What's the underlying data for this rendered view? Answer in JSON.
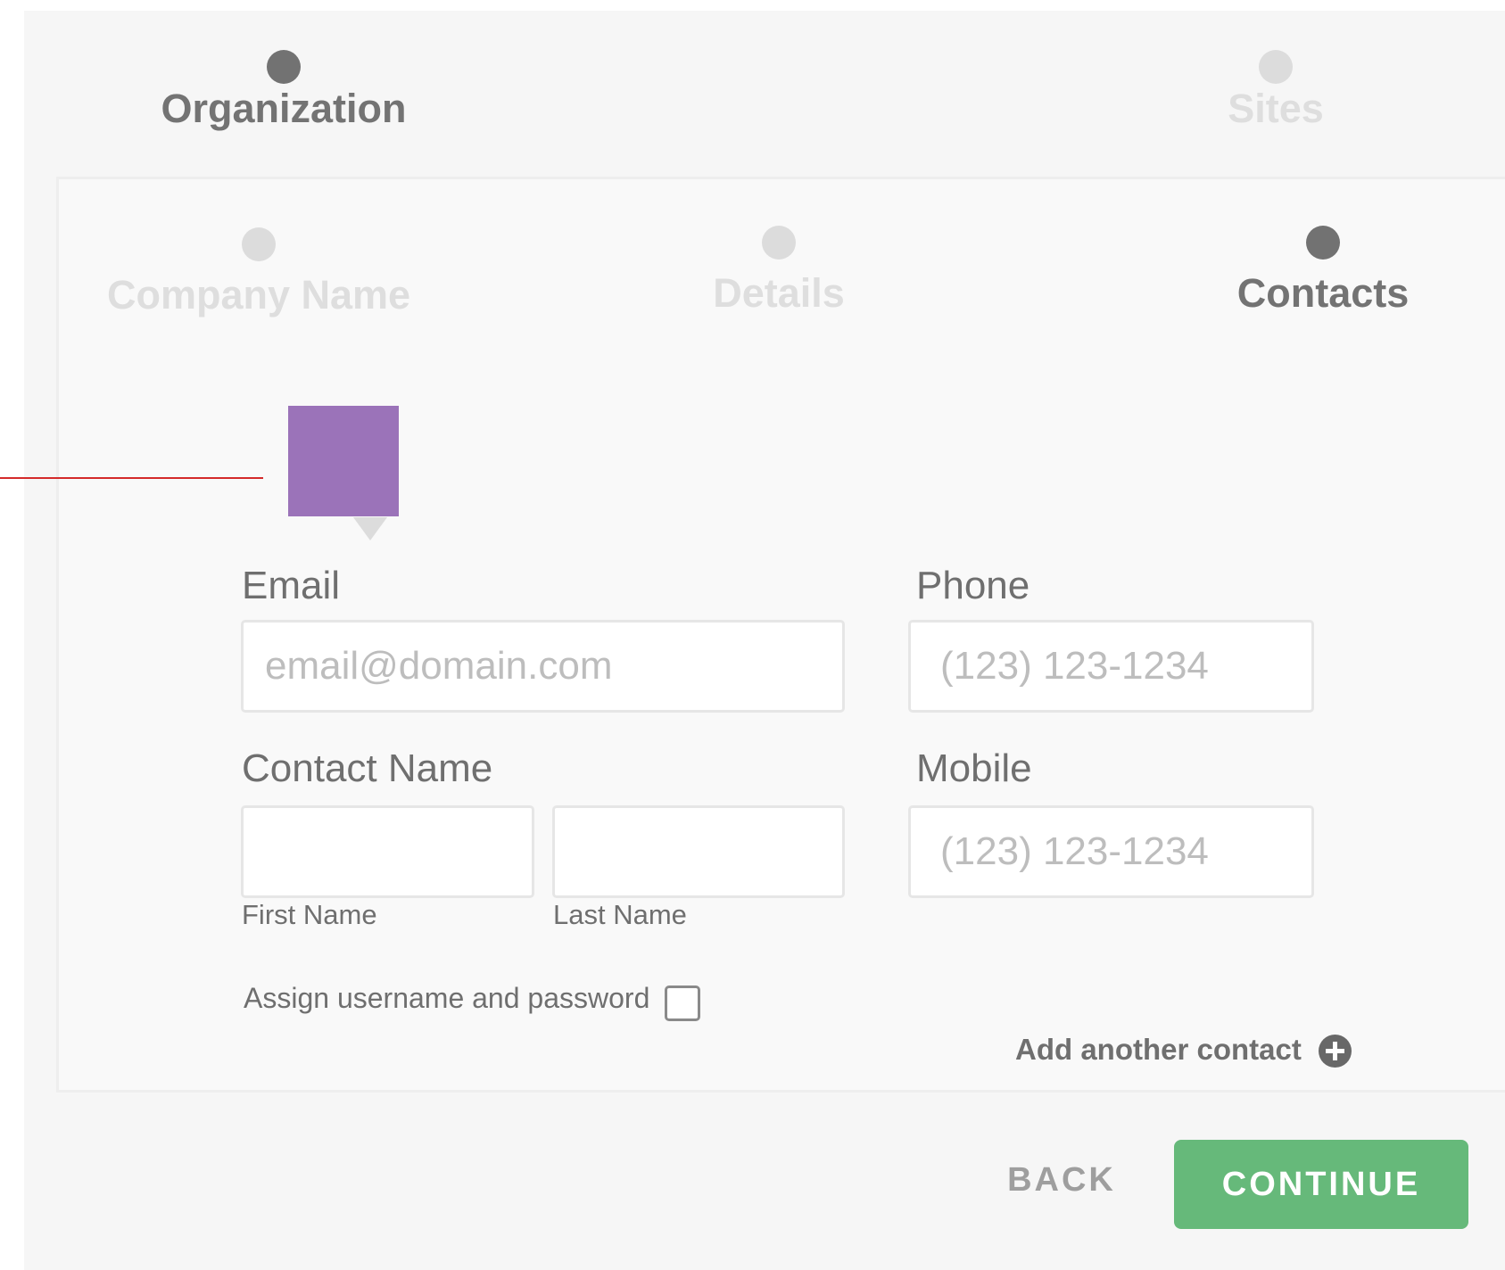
{
  "top_steps": {
    "organization": "Organization",
    "sites": "Sites"
  },
  "sub_steps": {
    "company_name": "Company Name",
    "details": "Details",
    "contacts": "Contacts"
  },
  "form": {
    "email_label": "Email",
    "email_placeholder": "email@domain.com",
    "phone_label": "Phone",
    "phone_placeholder": "(123) 123-1234",
    "contact_name_label": "Contact Name",
    "first_name_label": "First Name",
    "last_name_label": "Last Name",
    "mobile_label": "Mobile",
    "mobile_placeholder": "(123) 123-1234",
    "assign_label": "Assign username and password",
    "add_contact_label": "Add another contact"
  },
  "footer": {
    "back_label": "BACK",
    "continue_label": "CONTINUE"
  },
  "colors": {
    "accent_purple": "#9b73b9",
    "continue_green": "#66b97a",
    "connector_red": "#d42a2a"
  }
}
